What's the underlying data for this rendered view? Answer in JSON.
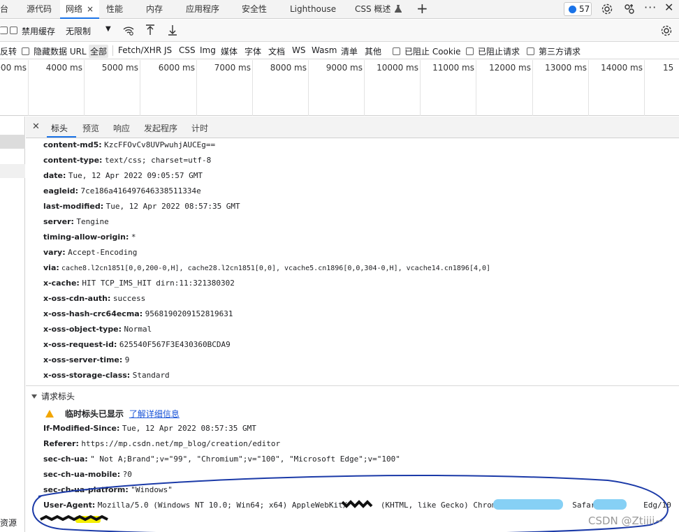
{
  "tabs": [
    {
      "label": "台",
      "active": false
    },
    {
      "label": "源代码",
      "active": false
    },
    {
      "label": "网络",
      "active": true
    },
    {
      "label": "性能",
      "active": false
    },
    {
      "label": "内存",
      "active": false
    },
    {
      "label": "应用程序",
      "active": false
    },
    {
      "label": "安全性",
      "active": false
    },
    {
      "label": "Lighthouse",
      "active": false
    },
    {
      "label": "CSS 概述",
      "active": false
    }
  ],
  "tab_close": "×",
  "flask_icon": "flask-icon",
  "issues_count": "57",
  "toolbar": {
    "disable_cache": "禁用缓存",
    "throttle": "无限制"
  },
  "filters": {
    "invert": "反转",
    "hide_data_url": "隐藏数据 URL",
    "all": "全部",
    "types": [
      "Fetch/XHR",
      "JS",
      "CSS",
      "Img",
      "媒体",
      "字体",
      "文档",
      "WS",
      "Wasm",
      "清单",
      "其他"
    ],
    "blocked_cookies": "已阻止 Cookie",
    "blocked_requests": "已阻止请求",
    "third_party": "第三方请求"
  },
  "timeline_ticks": [
    "000 ms",
    "4000 ms",
    "5000 ms",
    "6000 ms",
    "7000 ms",
    "8000 ms",
    "9000 ms",
    "10000 ms",
    "11000 ms",
    "12000 ms",
    "13000 ms",
    "14000 ms",
    "15"
  ],
  "detail_tabs": [
    "标头",
    "预览",
    "响应",
    "发起程序",
    "计时"
  ],
  "response_headers": [
    {
      "name": "content-md5:",
      "value": "KzcFFOvCv8UVPwuhjAUCEg=="
    },
    {
      "name": "content-type:",
      "value": "text/css; charset=utf-8"
    },
    {
      "name": "date:",
      "value": "Tue, 12 Apr 2022 09:05:57 GMT"
    },
    {
      "name": "eagleid:",
      "value": "7ce186a416497646338511334e"
    },
    {
      "name": "last-modified:",
      "value": "Tue, 12 Apr 2022 08:57:35 GMT"
    },
    {
      "name": "server:",
      "value": "Tengine"
    },
    {
      "name": "timing-allow-origin:",
      "value": "*"
    },
    {
      "name": "vary:",
      "value": "Accept-Encoding"
    },
    {
      "name": "via:",
      "value": "cache8.l2cn1851[0,0,200-0,H], cache28.l2cn1851[0,0], vcache5.cn1896[0,0,304-0,H], vcache14.cn1896[4,0]"
    },
    {
      "name": "x-cache:",
      "value": "HIT TCP_IMS_HIT dirn:11:321380302"
    },
    {
      "name": "x-oss-cdn-auth:",
      "value": "success"
    },
    {
      "name": "x-oss-hash-crc64ecma:",
      "value": "9568190209152819631"
    },
    {
      "name": "x-oss-object-type:",
      "value": "Normal"
    },
    {
      "name": "x-oss-request-id:",
      "value": "625540F567F3E430360BCDA9"
    },
    {
      "name": "x-oss-server-time:",
      "value": "9"
    },
    {
      "name": "x-oss-storage-class:",
      "value": "Standard"
    }
  ],
  "request_section": {
    "title": "请求标头",
    "warning": "临时标头已显示",
    "learn_more": "了解详细信息",
    "headers": [
      {
        "name": "If-Modified-Since:",
        "value": "Tue, 12 Apr 2022 08:57:35 GMT"
      },
      {
        "name": "Referer:",
        "value": "https://mp.csdn.net/mp_blog/creation/editor"
      },
      {
        "name": "sec-ch-ua:",
        "value": "\" Not A;Brand\";v=\"99\", \"Chromium\";v=\"100\", \"Microsoft Edge\";v=\"100\""
      },
      {
        "name": "sec-ch-ua-mobile:",
        "value": "?0"
      },
      {
        "name": "sec-ch-ua-platform:",
        "value": "\"Windows\""
      }
    ],
    "user_agent_name": "User-Agent:",
    "user_agent_a": "Mozilla/5.0 (Windows NT 10.0; Win64; x64) AppleWebKit/",
    "user_agent_b": "(KHTML, like Gecko) Chrome/",
    "user_agent_c": "Safari/",
    "user_agent_d": "Edg/10"
  },
  "left_cut_text": "资源",
  "watermark": "CSDN @Ztiiii~"
}
